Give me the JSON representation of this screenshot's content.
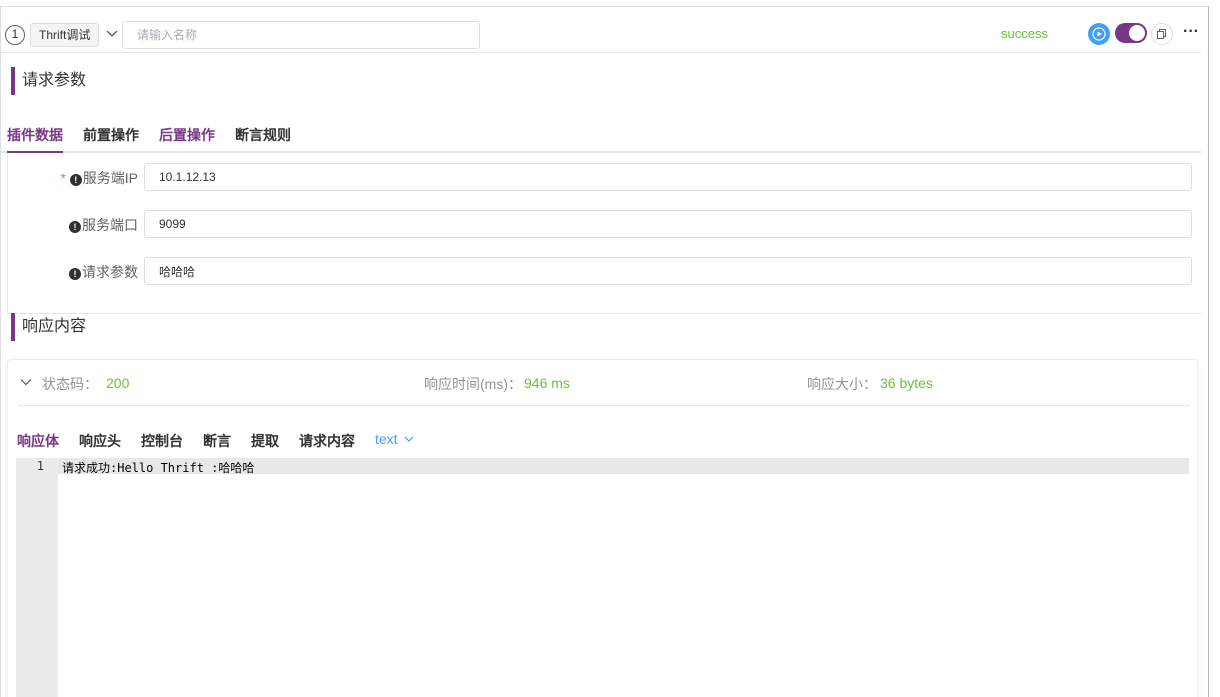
{
  "header": {
    "step_number": "1",
    "type_tag": "Thrift调试",
    "name_placeholder": "请输入名称",
    "status": "success"
  },
  "request": {
    "section_title": "请求参数",
    "tabs": [
      "插件数据",
      "前置操作",
      "后置操作",
      "断言规则"
    ],
    "fields": [
      {
        "label": "服务端IP",
        "required": true,
        "value": "10.1.12.13"
      },
      {
        "label": "服务端口",
        "required": false,
        "value": "9099"
      },
      {
        "label": "请求参数",
        "required": false,
        "value": "哈哈哈"
      }
    ]
  },
  "response": {
    "section_title": "响应内容",
    "status_code_label": "状态码：",
    "status_code": "200",
    "time_label": "响应时间(ms)：",
    "time_value": "946 ms",
    "size_label": "响应大小：",
    "size_value": "36 bytes",
    "tabs": [
      "响应体",
      "响应头",
      "控制台",
      "断言",
      "提取",
      "请求内容"
    ],
    "format": "text",
    "body_lines": [
      {
        "num": "1",
        "text": "请求成功:Hello Thrift :哈哈哈"
      }
    ]
  },
  "colors": {
    "accent": "#783887",
    "success": "#67c23a",
    "primary": "#409eff"
  }
}
